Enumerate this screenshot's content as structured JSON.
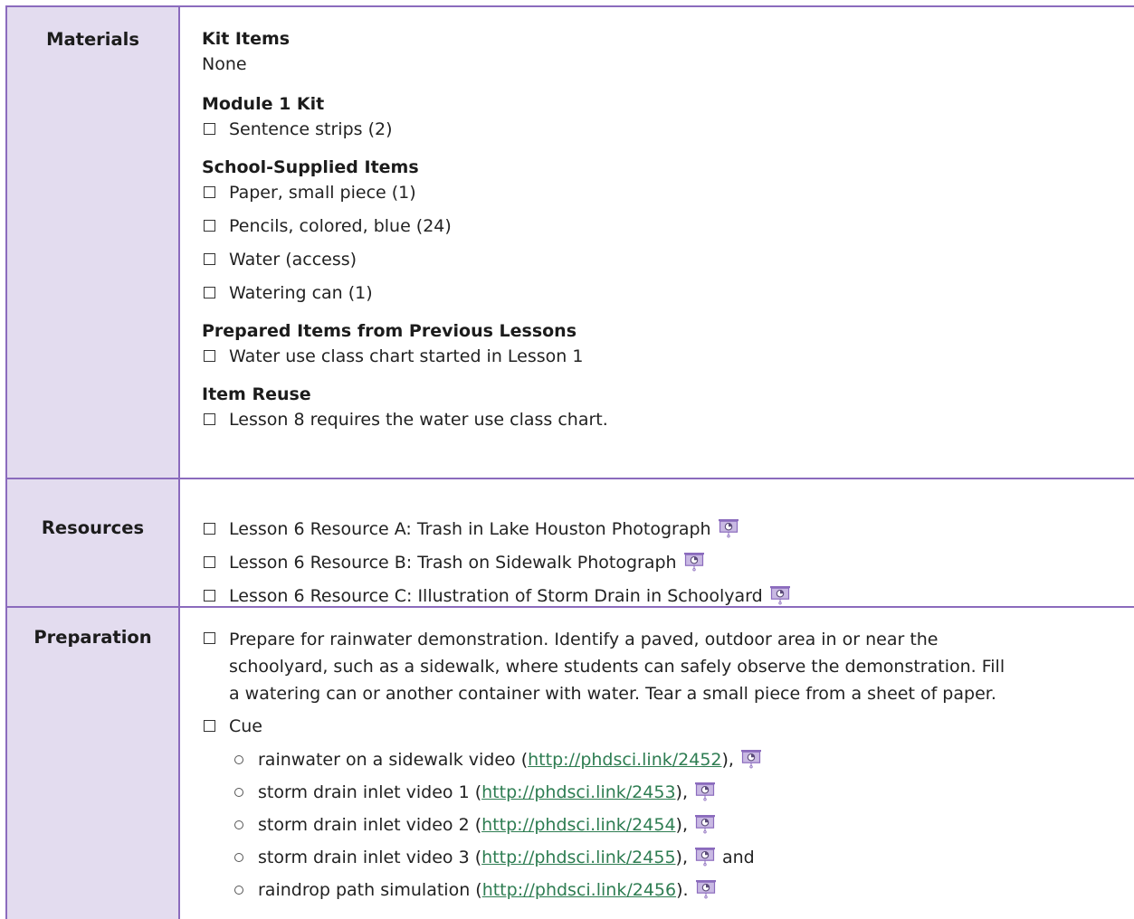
{
  "materials": {
    "label": "Materials",
    "kit_items_title": "Kit Items",
    "kit_items_value": "None",
    "module_kit_title": "Module 1 Kit",
    "module_kit_items": [
      "Sentence strips (2)"
    ],
    "school_supplied_title": "School-Supplied Items",
    "school_supplied_items": [
      "Paper, small piece (1)",
      "Pencils, colored, blue (24)",
      "Water (access)",
      "Watering can (1)"
    ],
    "prepared_title": "Prepared Items from Previous Lessons",
    "prepared_items": [
      "Water use class chart started in Lesson 1"
    ],
    "reuse_title": "Item Reuse",
    "reuse_items": [
      "Lesson 8 requires the water use class chart."
    ]
  },
  "resources": {
    "label": "Resources",
    "items": [
      "Lesson 6 Resource A: Trash in Lake Houston Photograph",
      "Lesson 6 Resource B: Trash on Sidewalk Photograph",
      "Lesson 6 Resource C: Illustration of Storm Drain in Schoolyard"
    ],
    "icon": "projector-screen-icon"
  },
  "preparation": {
    "label": "Preparation",
    "prep_lines": [
      "Prepare for rainwater demonstration. Identify a paved, outdoor area in or near the",
      "schoolyard, such as a sidewalk, where students can safely observe the demonstration. Fill",
      "a watering can or another container with water. Tear a small piece from a sheet of paper."
    ],
    "cue_label": "Cue",
    "cues": [
      {
        "pre": "rainwater on a sidewalk video (",
        "link": "http://phdsci.link/2452",
        "post": "),",
        "after": ""
      },
      {
        "pre": "storm drain inlet video 1 (",
        "link": "http://phdsci.link/2453",
        "post": "),",
        "after": ""
      },
      {
        "pre": "storm drain inlet video 2 (",
        "link": "http://phdsci.link/2454",
        "post": "),",
        "after": ""
      },
      {
        "pre": "storm drain inlet video 3 (",
        "link": "http://phdsci.link/2455",
        "post": "),",
        "after": "and"
      },
      {
        "pre": "raindrop path simulation (",
        "link": "http://phdsci.link/2456",
        "post": ").",
        "after": ""
      }
    ]
  },
  "colors": {
    "border": "#8b6bbd",
    "label_background": "#e3dcef",
    "link": "#2e7d52",
    "icon_fill": "#c9b9e3"
  }
}
